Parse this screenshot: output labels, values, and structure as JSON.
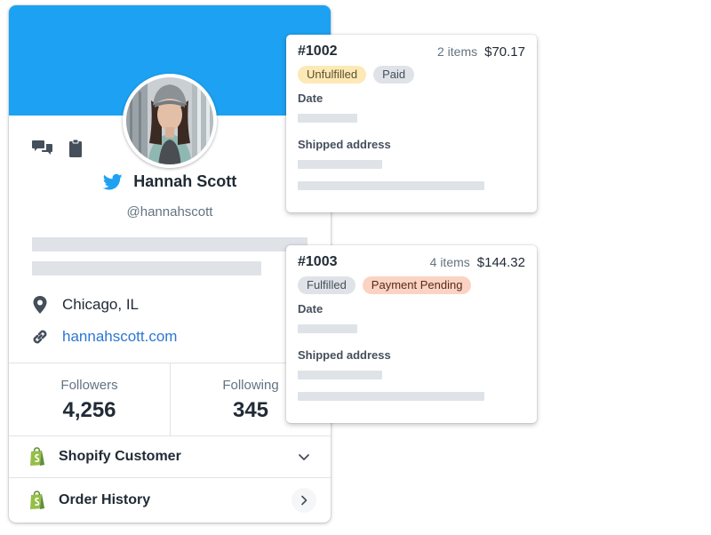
{
  "profile": {
    "name": "Hannah Scott",
    "handle": "@hannahscott",
    "location": "Chicago, IL",
    "website": "hannahscott.com",
    "stats": [
      {
        "label": "Followers",
        "value": "4,256"
      },
      {
        "label": "Following",
        "value": "345"
      }
    ],
    "rows": [
      {
        "label": "Shopify Customer",
        "icon": "chevron-down-icon"
      },
      {
        "label": "Order History",
        "icon": "chevron-right-icon"
      }
    ],
    "colors": {
      "banner": "#1da1f2",
      "link": "#2c77d4"
    }
  },
  "orders": [
    {
      "number": "#1002",
      "items": "2 items",
      "price": "$70.17",
      "badges": [
        "Unfulfilled",
        "Paid"
      ],
      "date_label": "Date",
      "address_label": "Shipped address"
    },
    {
      "number": "#1003",
      "items": "4 items",
      "price": "$144.32",
      "badges": [
        "Fulfilled",
        "Payment Pending"
      ],
      "date_label": "Date",
      "address_label": "Shipped address"
    }
  ]
}
